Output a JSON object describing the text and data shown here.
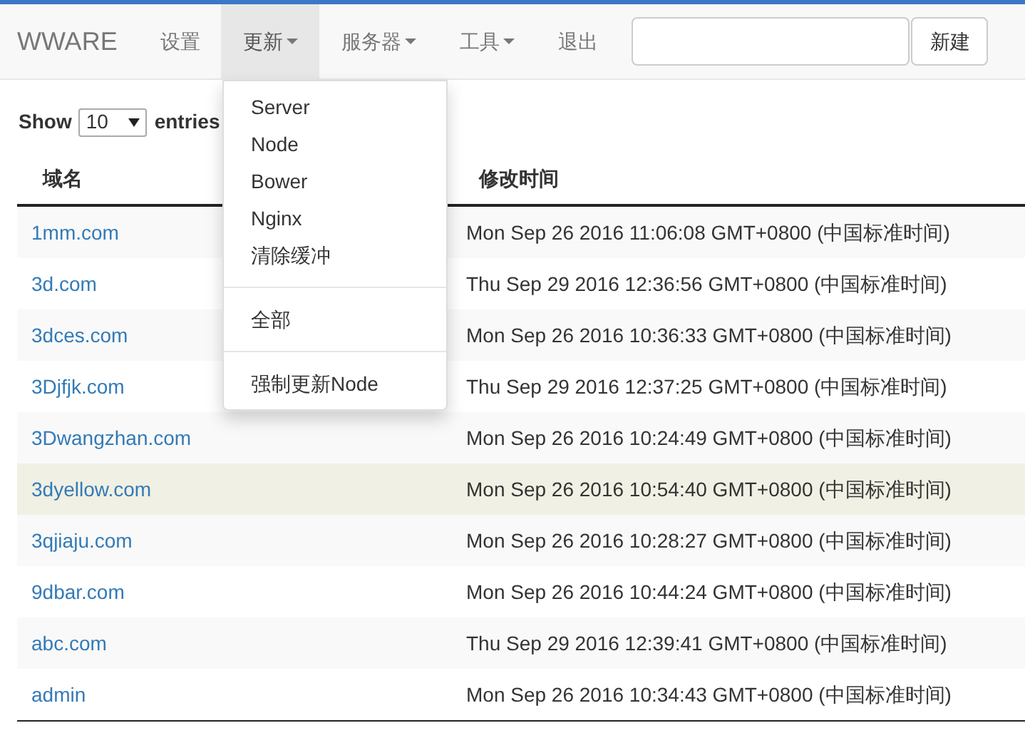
{
  "navbar": {
    "brand": "WWARE",
    "items": [
      {
        "label": "设置",
        "selected": false,
        "dropdown": false
      },
      {
        "label": "更新",
        "selected": true,
        "dropdown": true
      },
      {
        "label": "服务器",
        "selected": false,
        "dropdown": true
      },
      {
        "label": "工具",
        "selected": false,
        "dropdown": true
      },
      {
        "label": "退出",
        "selected": false,
        "dropdown": false
      }
    ],
    "new_button": "新建"
  },
  "dropdown_menu": [
    {
      "kind": "item",
      "label": "Server"
    },
    {
      "kind": "item",
      "label": "Node"
    },
    {
      "kind": "item",
      "label": "Bower"
    },
    {
      "kind": "item",
      "label": "Nginx"
    },
    {
      "kind": "item",
      "label": "清除缓冲"
    },
    {
      "kind": "divider"
    },
    {
      "kind": "item",
      "label": "全部"
    },
    {
      "kind": "divider"
    },
    {
      "kind": "item",
      "label": "强制更新Node"
    }
  ],
  "length_control": {
    "prefix": "Show",
    "value": "10",
    "suffix": "entries"
  },
  "table": {
    "columns": [
      "域名",
      "修改时间"
    ],
    "rows": [
      {
        "domain": "1mm.com",
        "modified": "Mon Sep 26 2016 11:06:08 GMT+0800 (中国标准时间)",
        "highlighted": false
      },
      {
        "domain": "3d.com",
        "modified": "Thu Sep 29 2016 12:36:56 GMT+0800 (中国标准时间)",
        "highlighted": false
      },
      {
        "domain": "3dces.com",
        "modified": "Mon Sep 26 2016 10:36:33 GMT+0800 (中国标准时间)",
        "highlighted": false
      },
      {
        "domain": "3Djfjk.com",
        "modified": "Thu Sep 29 2016 12:37:25 GMT+0800 (中国标准时间)",
        "highlighted": false
      },
      {
        "domain": "3Dwangzhan.com",
        "modified": "Mon Sep 26 2016 10:24:49 GMT+0800 (中国标准时间)",
        "highlighted": false
      },
      {
        "domain": "3dyellow.com",
        "modified": "Mon Sep 26 2016 10:54:40 GMT+0800 (中国标准时间)",
        "highlighted": true
      },
      {
        "domain": "3qjiaju.com",
        "modified": "Mon Sep 26 2016 10:28:27 GMT+0800 (中国标准时间)",
        "highlighted": false
      },
      {
        "domain": "9dbar.com",
        "modified": "Mon Sep 26 2016 10:44:24 GMT+0800 (中国标准时间)",
        "highlighted": false
      },
      {
        "domain": "abc.com",
        "modified": "Thu Sep 29 2016 12:39:41 GMT+0800 (中国标准时间)",
        "highlighted": false
      },
      {
        "domain": "admin",
        "modified": "Mon Sep 26 2016 10:34:43 GMT+0800 (中国标准时间)",
        "highlighted": false
      }
    ]
  }
}
